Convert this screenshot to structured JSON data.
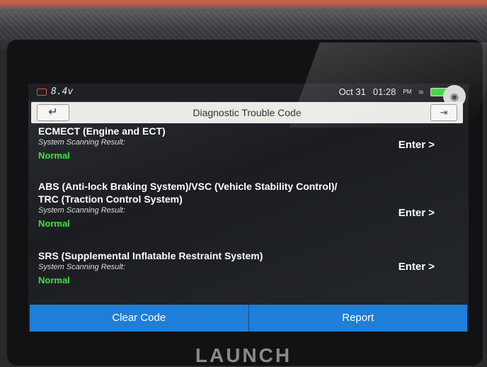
{
  "status_bar": {
    "voltage": "8.4v",
    "date": "Oct 31",
    "time": "01:28",
    "ampm": "PM"
  },
  "header": {
    "title": "Diagnostic Trouble Code",
    "back_icon": "back-arrow-icon",
    "exit_icon": "exit-icon"
  },
  "systems": [
    {
      "name": "ECMECT (Engine and ECT)",
      "scan_label": "System Scanning Result:",
      "result": "Normal",
      "enter_label": "Enter >"
    },
    {
      "name": "ABS (Anti-lock Braking System)/VSC (Vehicle Stability Control)/",
      "name_line2": "TRC (Traction Control System)",
      "scan_label": "System Scanning Result:",
      "result": "Normal",
      "enter_label": "Enter >"
    },
    {
      "name": "SRS (Supplemental Inflatable Restraint System)",
      "scan_label": "System Scanning Result:",
      "result": "Normal",
      "enter_label": "Enter >"
    }
  ],
  "footer": {
    "clear_label": "Clear Code",
    "report_label": "Report"
  },
  "device": {
    "brand": "LAUNCH"
  },
  "colors": {
    "accent": "#1f7ed8",
    "normal_status": "#3ee03e",
    "battery": "#3fd33f"
  }
}
